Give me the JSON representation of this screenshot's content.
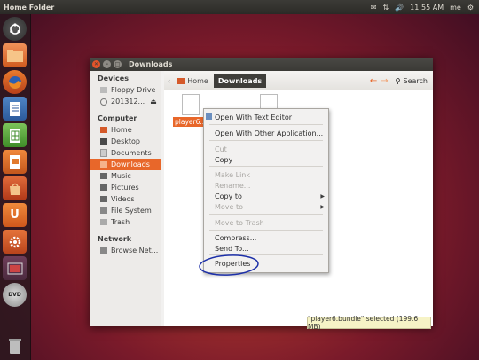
{
  "topbar": {
    "title": "Home Folder",
    "time": "11:55 AM",
    "user": "me"
  },
  "launcher": {
    "items": [
      "dash-home-icon",
      "files-icon",
      "firefox-icon",
      "writer-icon",
      "calc-icon",
      "impress-icon",
      "software-center-icon",
      "ubuntu-one-icon",
      "system-settings-icon",
      "workspaces-icon",
      "dvd-icon",
      "trash-icon"
    ],
    "dvd_label": "DVD",
    "u_label": "U"
  },
  "window": {
    "title": "Downloads",
    "breadcrumb": [
      "Home",
      "Downloads"
    ],
    "search_label": "Search"
  },
  "sidebar": {
    "sections": [
      {
        "heading": "Devices",
        "items": [
          "Floppy Drive",
          "201312..."
        ]
      },
      {
        "heading": "Computer",
        "items": [
          "Home",
          "Desktop",
          "Documents",
          "Downloads",
          "Music",
          "Pictures",
          "Videos",
          "File System",
          "Trash"
        ]
      },
      {
        "heading": "Network",
        "items": [
          "Browse Net..."
        ]
      }
    ]
  },
  "files": [
    {
      "name": "player6..."
    }
  ],
  "context_menu": {
    "items": [
      {
        "label": "Open With Text Editor",
        "disabled": false
      },
      {
        "label": "Open With Other Application...",
        "disabled": false
      },
      {
        "label": "Cut",
        "disabled": true
      },
      {
        "label": "Copy",
        "disabled": false
      },
      {
        "label": "Make Link",
        "disabled": true
      },
      {
        "label": "Rename...",
        "disabled": true
      },
      {
        "label": "Copy to",
        "disabled": false
      },
      {
        "label": "Move to",
        "disabled": true
      },
      {
        "label": "Move to Trash",
        "disabled": true
      },
      {
        "label": "Compress...",
        "disabled": false
      },
      {
        "label": "Send To...",
        "disabled": false
      },
      {
        "label": "Properties",
        "disabled": false
      }
    ]
  },
  "status": "\"player6.bundle\" selected (199.6 MB)",
  "colors": {
    "accent": "#e8672a",
    "annotation": "#1c2fa8"
  }
}
